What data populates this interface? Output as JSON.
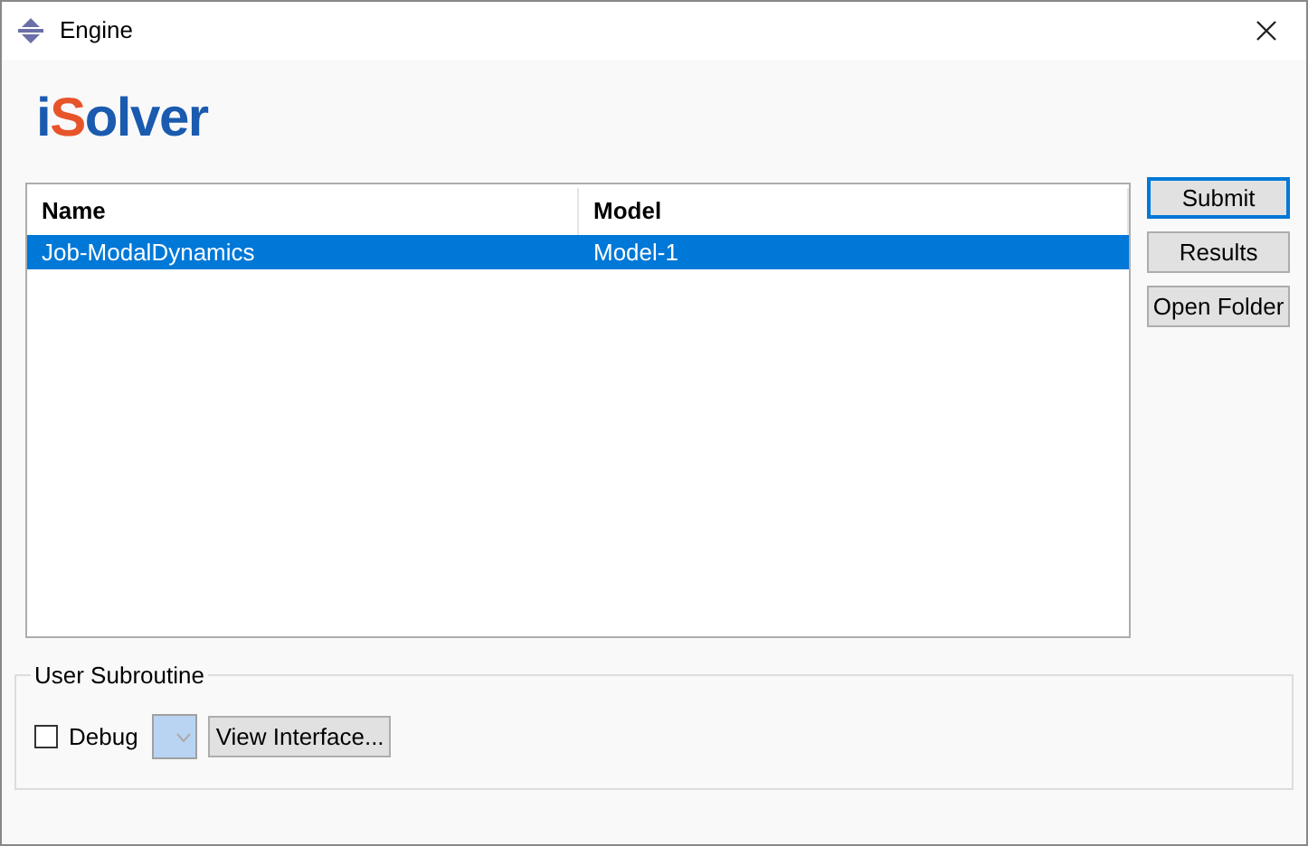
{
  "window": {
    "title": "Engine"
  },
  "logo": {
    "text": "iSolver"
  },
  "table": {
    "columns": [
      "Name",
      "Model"
    ],
    "rows": [
      {
        "cells": [
          "Job-ModalDynamics",
          "Model-1"
        ],
        "selected": true
      }
    ]
  },
  "buttons": [
    {
      "label": "Submit",
      "default": true
    },
    {
      "label": "Results",
      "default": false
    },
    {
      "label": "Open Folder",
      "default": false
    }
  ],
  "user_subroutine": {
    "title": "User Subroutine",
    "debug": {
      "label": "Debug",
      "checked": false
    },
    "view_button": "View Interface..."
  }
}
